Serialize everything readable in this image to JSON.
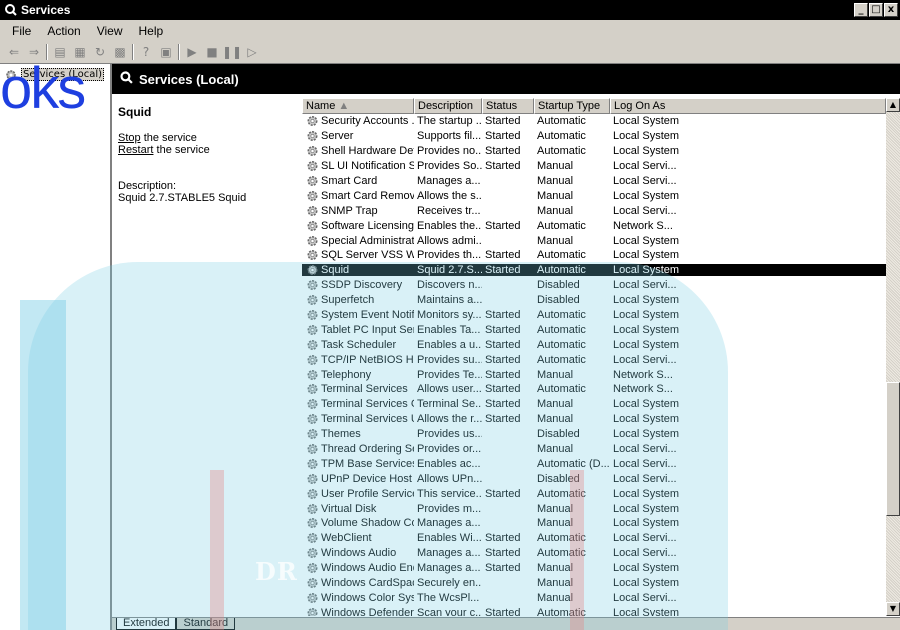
{
  "window": {
    "title": "Services",
    "buttons": [
      "_",
      "□",
      "x"
    ]
  },
  "menu": [
    "File",
    "Action",
    "View",
    "Help"
  ],
  "toolbar": [
    "back-icon",
    "forward-icon",
    "up-icon",
    "properties-icon",
    "refresh-icon",
    "export-icon",
    "help-icon",
    "view-icon",
    "start-icon",
    "stop-icon",
    "pause-icon",
    "restart-icon"
  ],
  "tree": {
    "root_label": "Services (Local)"
  },
  "panel": {
    "title": "Services (Local)",
    "service_name": "Squid",
    "stop_link_u": "Stop",
    "stop_link_rest": " the service",
    "restart_link_u": "Restart",
    "restart_link_rest": " the service",
    "description_label": "Description:",
    "description_text": "Squid 2.7.STABLE5 Squid"
  },
  "columns": {
    "name": "Name",
    "description": "Description",
    "status": "Status",
    "startup": "Startup Type",
    "logon": "Log On As"
  },
  "selected_row": 10,
  "services": [
    [
      "Security Accounts ...",
      "The startup ...",
      "Started",
      "Automatic",
      "Local System"
    ],
    [
      "Server",
      "Supports fil...",
      "Started",
      "Automatic",
      "Local System"
    ],
    [
      "Shell Hardware Det...",
      "Provides no...",
      "Started",
      "Automatic",
      "Local System"
    ],
    [
      "SL UI Notification S...",
      "Provides So...",
      "Started",
      "Manual",
      "Local Servi..."
    ],
    [
      "Smart Card",
      "Manages a...",
      "",
      "Manual",
      "Local Servi..."
    ],
    [
      "Smart Card Removal...",
      "Allows the s...",
      "",
      "Manual",
      "Local System"
    ],
    [
      "SNMP Trap",
      "Receives tr...",
      "",
      "Manual",
      "Local Servi..."
    ],
    [
      "Software Licensing",
      "Enables the...",
      "Started",
      "Automatic",
      "Network S..."
    ],
    [
      "Special Administratio...",
      "Allows admi...",
      "",
      "Manual",
      "Local System"
    ],
    [
      "SQL Server VSS Wr...",
      "Provides th...",
      "Started",
      "Automatic",
      "Local System"
    ],
    [
      "Squid",
      "Squid 2.7.S...",
      "Started",
      "Automatic",
      "Local System"
    ],
    [
      "SSDP Discovery",
      "Discovers n...",
      "",
      "Disabled",
      "Local Servi..."
    ],
    [
      "Superfetch",
      "Maintains a...",
      "",
      "Disabled",
      "Local System"
    ],
    [
      "System Event Notifi...",
      "Monitors sy...",
      "Started",
      "Automatic",
      "Local System"
    ],
    [
      "Tablet PC Input Ser...",
      "Enables Ta...",
      "Started",
      "Automatic",
      "Local System"
    ],
    [
      "Task Scheduler",
      "Enables a u...",
      "Started",
      "Automatic",
      "Local System"
    ],
    [
      "TCP/IP NetBIOS H...",
      "Provides su...",
      "Started",
      "Automatic",
      "Local Servi..."
    ],
    [
      "Telephony",
      "Provides Te...",
      "Started",
      "Manual",
      "Network S..."
    ],
    [
      "Terminal Services",
      "Allows user...",
      "Started",
      "Automatic",
      "Network S..."
    ],
    [
      "Terminal Services C...",
      "Terminal Se...",
      "Started",
      "Manual",
      "Local System"
    ],
    [
      "Terminal Services U...",
      "Allows the r...",
      "Started",
      "Manual",
      "Local System"
    ],
    [
      "Themes",
      "Provides us...",
      "",
      "Disabled",
      "Local System"
    ],
    [
      "Thread Ordering Ser...",
      "Provides or...",
      "",
      "Manual",
      "Local Servi..."
    ],
    [
      "TPM Base Services",
      "Enables ac...",
      "",
      "Automatic (D...",
      "Local Servi..."
    ],
    [
      "UPnP Device Host",
      "Allows UPn...",
      "",
      "Disabled",
      "Local Servi..."
    ],
    [
      "User Profile Service",
      "This service...",
      "Started",
      "Automatic",
      "Local System"
    ],
    [
      "Virtual Disk",
      "Provides m...",
      "",
      "Manual",
      "Local System"
    ],
    [
      "Volume Shadow Copy",
      "Manages a...",
      "",
      "Manual",
      "Local System"
    ],
    [
      "WebClient",
      "Enables Wi...",
      "Started",
      "Automatic",
      "Local Servi..."
    ],
    [
      "Windows Audio",
      "Manages a...",
      "Started",
      "Automatic",
      "Local Servi..."
    ],
    [
      "Windows Audio End...",
      "Manages a...",
      "Started",
      "Manual",
      "Local System"
    ],
    [
      "Windows CardSpace",
      "Securely en...",
      "",
      "Manual",
      "Local System"
    ],
    [
      "Windows Color Syst...",
      "The WcsPl...",
      "",
      "Manual",
      "Local Servi..."
    ],
    [
      "Windows Defender",
      "Scan your c...",
      "Started",
      "Automatic",
      "Local System"
    ]
  ],
  "tabs": [
    "Extended",
    "Standard"
  ],
  "watermark": {
    "top_text": "oks",
    "bottom_text": "DR"
  }
}
